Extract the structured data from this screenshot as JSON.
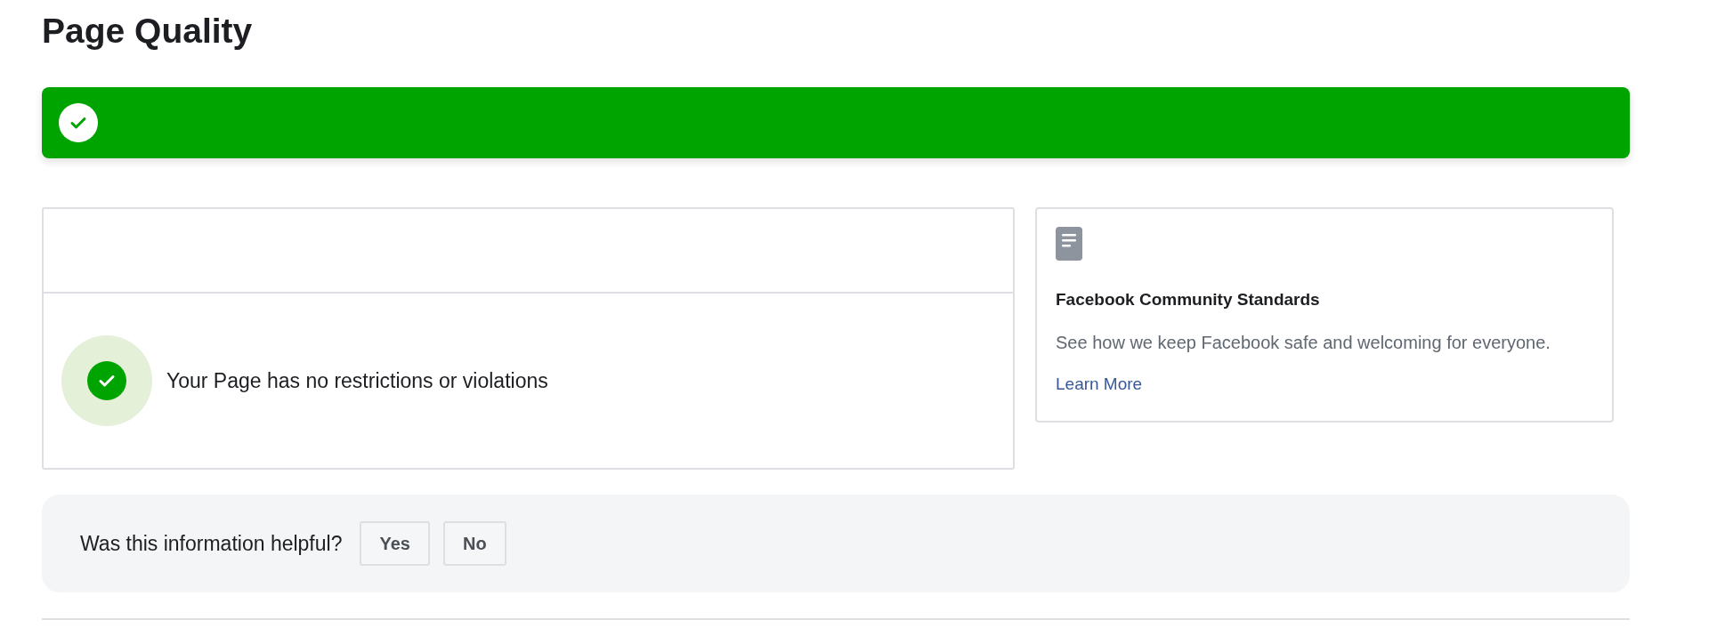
{
  "title": "Page Quality",
  "status_banner": {
    "passed": true
  },
  "status_card": {
    "passed": true,
    "message": "Your Page has no restrictions or violations"
  },
  "resource_card": {
    "title": "Facebook Community Standards",
    "description": "See how we keep Facebook safe and welcoming for everyone.",
    "link": "Learn More"
  },
  "feedback": {
    "question": "Was this information helpful?",
    "buttons": [
      "Yes",
      "No"
    ]
  }
}
